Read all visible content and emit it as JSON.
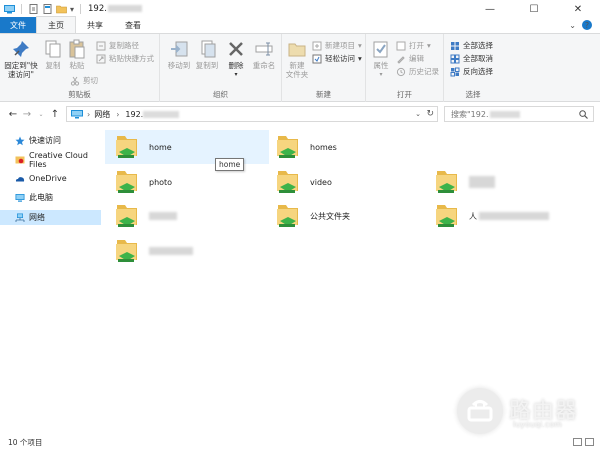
{
  "titlebar": {
    "title": "192.",
    "controls": {
      "minimize": "—",
      "maximize": "☐",
      "close": "✕"
    }
  },
  "tabs": [
    {
      "label": "文件"
    },
    {
      "label": "主页"
    },
    {
      "label": "共享"
    },
    {
      "label": "查看"
    }
  ],
  "ribbon": {
    "clipboard": {
      "label": "剪贴板",
      "pin": "固定到\"快\n速访问\"",
      "copy": "复制",
      "paste": "粘贴",
      "copy_path": "复制路径",
      "paste_shortcut": "粘贴快捷方式",
      "cut": "剪切"
    },
    "organize": {
      "label": "组织",
      "move_to": "移动到",
      "copy_to": "复制到",
      "delete": "删除",
      "rename": "重命名"
    },
    "new": {
      "label": "新建",
      "new_folder": "新建\n文件夹",
      "new_item": "新建项目",
      "easy_access": "轻松访问"
    },
    "open": {
      "label": "打开",
      "properties": "属性",
      "open": "打开",
      "edit": "编辑",
      "history": "历史记录"
    },
    "select": {
      "label": "选择",
      "select_all": "全部选择",
      "select_none": "全部取消",
      "invert": "反向选择"
    }
  },
  "address": {
    "root": "网络",
    "host": "192.",
    "search_placeholder": "搜索\"192."
  },
  "navpane": [
    {
      "label": "快速访问",
      "icon": "star-icon"
    },
    {
      "label": "Creative Cloud Files",
      "icon": "creative-cloud-icon"
    },
    {
      "label": "OneDrive",
      "icon": "onedrive-icon"
    },
    {
      "label": "此电脑",
      "icon": "pc-icon"
    },
    {
      "label": "网络",
      "icon": "network-icon",
      "selected": true
    }
  ],
  "items": [
    {
      "label": "home",
      "hover": true
    },
    {
      "label": "homes"
    },
    {
      "label": ""
    },
    {
      "label": "photo"
    },
    {
      "label": "video"
    },
    {
      "label": "",
      "blurred": true
    },
    {
      "label": "",
      "blurred": true
    },
    {
      "label": "公共文件夹"
    },
    {
      "label": "人",
      "blurred": true
    },
    {
      "label": "",
      "blurred": true
    }
  ],
  "tooltip": "home",
  "status": {
    "count": "10 个项目"
  },
  "watermark": {
    "brand": "路由器",
    "url": "luyouqi.com"
  },
  "colors": {
    "accent": "#1979ca",
    "selected": "#cce8ff",
    "hover": "#e5f3ff",
    "folder": "#f2c25b",
    "share_green": "#3db34a"
  }
}
